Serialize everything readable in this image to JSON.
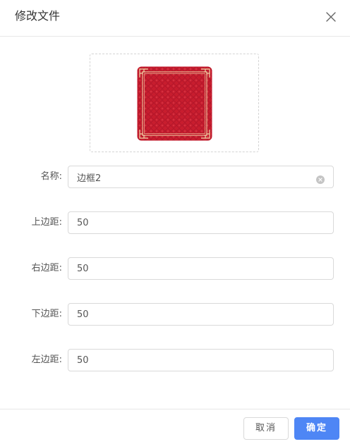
{
  "dialog": {
    "title": "修改文件"
  },
  "preview": {
    "image": "red-border-frame-thumbnail",
    "frame_color": "#c81d2e",
    "ornament_color": "#f1d6a8"
  },
  "form": {
    "name": {
      "label": "名称:",
      "value": "边框2"
    },
    "top_margin": {
      "label": "上边距:",
      "value": "50"
    },
    "right_margin": {
      "label": "右边距:",
      "value": "50"
    },
    "bottom_margin": {
      "label": "下边距:",
      "value": "50"
    },
    "left_margin": {
      "label": "左边距:",
      "value": "50"
    }
  },
  "footer": {
    "cancel_label": "取消",
    "ok_label": "确定"
  },
  "colors": {
    "primary": "#4e86f5",
    "border": "#d9d9d9"
  }
}
